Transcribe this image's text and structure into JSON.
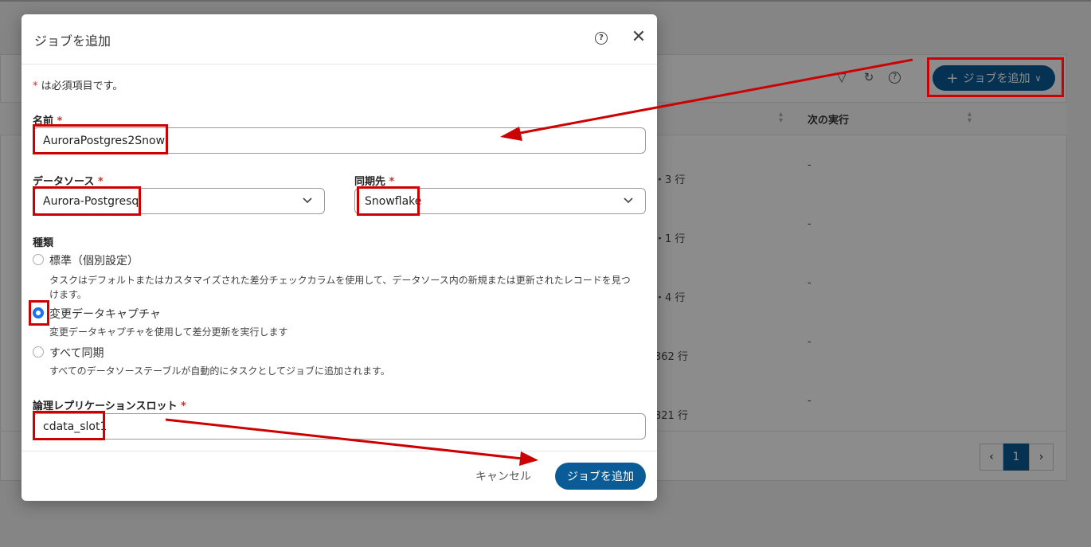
{
  "background": {
    "toolbar": {
      "add_job_label": "ジョブを追加"
    },
    "table": {
      "header_next_run": "次の実行",
      "rows": [
        {
          "count": "・3 行",
          "next": "-"
        },
        {
          "count": "・1 行",
          "next": "-"
        },
        {
          "count": "・4 行",
          "next": "-"
        },
        {
          "count": "362 行",
          "next": "-"
        },
        {
          "count": "321 行",
          "next": "-"
        }
      ]
    },
    "pager": {
      "current": "1",
      "prev": "‹",
      "next": "›"
    }
  },
  "modal": {
    "title": "ジョブを追加",
    "required_note": "は必須項目です。",
    "required_mark": "*",
    "name": {
      "label": "名前",
      "value": "AuroraPostgres2Snow"
    },
    "datasource": {
      "label": "データソース",
      "value": "Aurora-Postgresql"
    },
    "destination": {
      "label": "同期先",
      "value": "Snowflake"
    },
    "type": {
      "label": "種類",
      "options": [
        {
          "label": "標準（個別設定）",
          "desc_1": "タスクはデフォルトまたはカスタマイズされた差分チェックカラムを使用して、データソース内の新規または更新されたレコードを見つ",
          "desc_2": "けます。"
        },
        {
          "label": "変更データキャプチャ",
          "desc_1": "変更データキャプチャを使用して差分更新を実行します"
        },
        {
          "label": "すべて同期",
          "desc_1": "すべてのデータソーステーブルが自動的にタスクとしてジョブに追加されます。"
        }
      ],
      "selected_index": 1
    },
    "slot": {
      "label": "論理レプリケーションスロット",
      "value": "cdata_slot1"
    },
    "cancel_label": "キャンセル",
    "submit_label": "ジョブを追加"
  },
  "colors": {
    "primary": "#0a5c96",
    "radio": "#1a73e8",
    "annotation": "#cc0000",
    "required": "#c0392b"
  }
}
